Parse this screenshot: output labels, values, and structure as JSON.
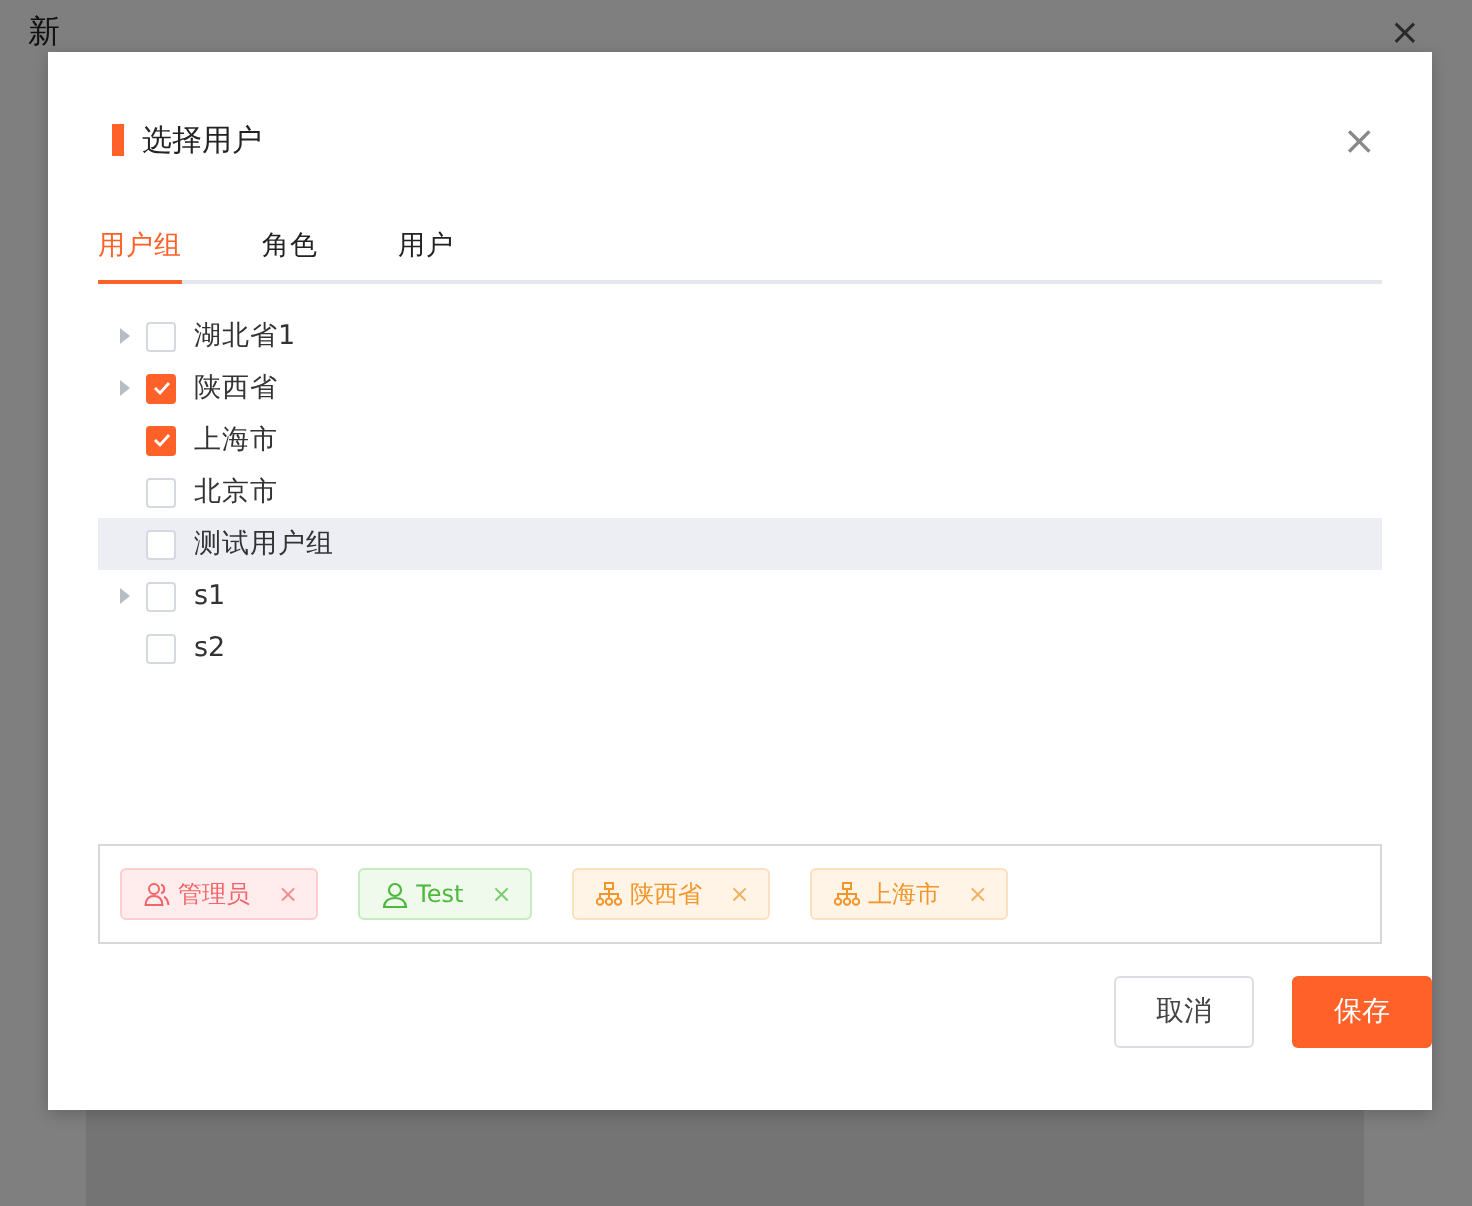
{
  "background_window": {
    "title": "新",
    "close": "×"
  },
  "dialog": {
    "title": "选择用户",
    "close": "×",
    "tabs": [
      {
        "label": "用户组",
        "selected": true
      },
      {
        "label": "角色",
        "selected": false
      },
      {
        "label": "用户",
        "selected": false
      }
    ],
    "tree": [
      {
        "label": "湖北省1",
        "checked": false,
        "expandable": true,
        "highlighted": false
      },
      {
        "label": "陕西省",
        "checked": true,
        "expandable": true,
        "highlighted": false
      },
      {
        "label": "上海市",
        "checked": true,
        "expandable": false,
        "highlighted": false
      },
      {
        "label": "北京市",
        "checked": false,
        "expandable": false,
        "highlighted": false
      },
      {
        "label": "测试用户组",
        "checked": false,
        "expandable": false,
        "highlighted": true
      },
      {
        "label": "s1",
        "checked": false,
        "expandable": true,
        "highlighted": false
      },
      {
        "label": "s2",
        "checked": false,
        "expandable": false,
        "highlighted": false
      }
    ],
    "selected_tags": [
      {
        "label": "管理员",
        "kind": "role",
        "remove": "×"
      },
      {
        "label": "Test",
        "kind": "user",
        "remove": "×"
      },
      {
        "label": "陕西省",
        "kind": "group",
        "remove": "×"
      },
      {
        "label": "上海市",
        "kind": "group",
        "remove": "×"
      }
    ],
    "buttons": [
      {
        "label": "取消",
        "kind": "secondary"
      },
      {
        "label": "保存",
        "kind": "primary"
      }
    ]
  }
}
